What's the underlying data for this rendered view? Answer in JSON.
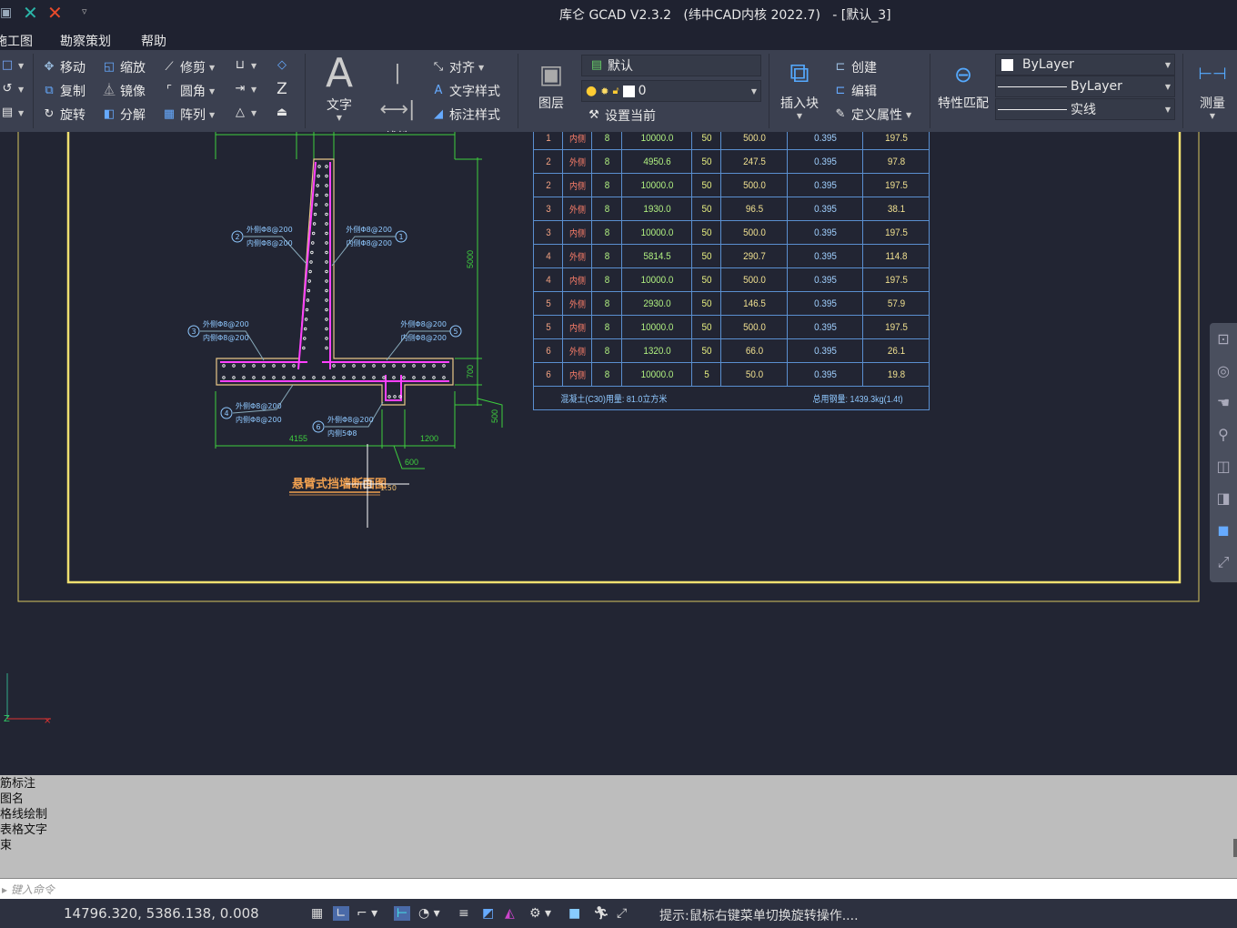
{
  "title": "库仑 GCAD V2.3.2   (纬中CAD内核 2022.7)   - [默认_3]",
  "menu": [
    "施工图",
    "勘察策划",
    "帮助"
  ],
  "modify": {
    "move": "移动",
    "copy": "复制",
    "rotate": "旋转",
    "scale": "缩放",
    "mirror": "镜像",
    "explode": "分解",
    "trim": "修剪",
    "fillet": "圆角",
    "array": "阵列"
  },
  "annotation": {
    "text": "文字",
    "linear": "线性",
    "align": "对齐",
    "text_style": "文字样式",
    "dim_style": "标注样式"
  },
  "layers": {
    "label": "图层",
    "current_layer_state": "默认",
    "layer_name": "0",
    "set_current": "设置当前"
  },
  "block": {
    "insert": "插入块",
    "create": "创建",
    "edit": "编辑",
    "define_attr": "定义属性"
  },
  "properties": {
    "match": "特性匹配",
    "color": "ByLayer",
    "linetype": "ByLayer",
    "lineweight": "实线"
  },
  "measure": "测量",
  "table": {
    "rows": [
      [
        "1",
        "内侧",
        "8",
        "10000.0",
        "50",
        "500.0",
        "0.395",
        "197.5"
      ],
      [
        "2",
        "外侧",
        "8",
        "4950.6",
        "50",
        "247.5",
        "0.395",
        "97.8"
      ],
      [
        "2",
        "内侧",
        "8",
        "10000.0",
        "50",
        "500.0",
        "0.395",
        "197.5"
      ],
      [
        "3",
        "外侧",
        "8",
        "1930.0",
        "50",
        "96.5",
        "0.395",
        "38.1"
      ],
      [
        "3",
        "内侧",
        "8",
        "10000.0",
        "50",
        "500.0",
        "0.395",
        "197.5"
      ],
      [
        "4",
        "外侧",
        "8",
        "5814.5",
        "50",
        "290.7",
        "0.395",
        "114.8"
      ],
      [
        "4",
        "内侧",
        "8",
        "10000.0",
        "50",
        "500.0",
        "0.395",
        "197.5"
      ],
      [
        "5",
        "外侧",
        "8",
        "2930.0",
        "50",
        "146.5",
        "0.395",
        "57.9"
      ],
      [
        "5",
        "内侧",
        "8",
        "10000.0",
        "50",
        "500.0",
        "0.395",
        "197.5"
      ],
      [
        "6",
        "外侧",
        "8",
        "1320.0",
        "50",
        "66.0",
        "0.395",
        "26.1"
      ],
      [
        "6",
        "内侧",
        "8",
        "10000.0",
        "5",
        "50.0",
        "0.395",
        "19.8"
      ]
    ],
    "footer_left": "混凝土(C30)用量: 81.0立方米",
    "footer_right": "总用钢量: 1439.3kg(1.4t)"
  },
  "drawing": {
    "title": "悬臂式挡墙断面图",
    "scale": "1:50",
    "dims": {
      "h_wall": "5000",
      "h_base": "700",
      "h_key": "500",
      "w_heel": "4155",
      "w_toe": "1200",
      "w_key": "600"
    },
    "labels": [
      {
        "num": "1",
        "l1": "外侧Φ8@200",
        "l2": "内侧Φ8@200"
      },
      {
        "num": "2",
        "l1": "外侧Φ8@200",
        "l2": "内侧Φ8@200"
      },
      {
        "num": "3",
        "l1": "外侧Φ8@200",
        "l2": "内侧Φ8@200"
      },
      {
        "num": "4",
        "l1": "外侧Φ8@200",
        "l2": "内侧Φ8@200"
      },
      {
        "num": "5",
        "l1": "外侧Φ8@200",
        "l2": "内侧Φ8@200"
      },
      {
        "num": "6",
        "l1": "外侧Φ8@200",
        "l2": "内侧5Φ8"
      }
    ]
  },
  "history": [
    "筋标注",
    "图名",
    "格线绘制",
    "表格文字",
    "束"
  ],
  "command_placeholder": "键入命令",
  "status": {
    "coords": "14796.320, 5386.138, 0.008",
    "hint": "提示:鼠标右键菜单切换旋转操作...."
  }
}
